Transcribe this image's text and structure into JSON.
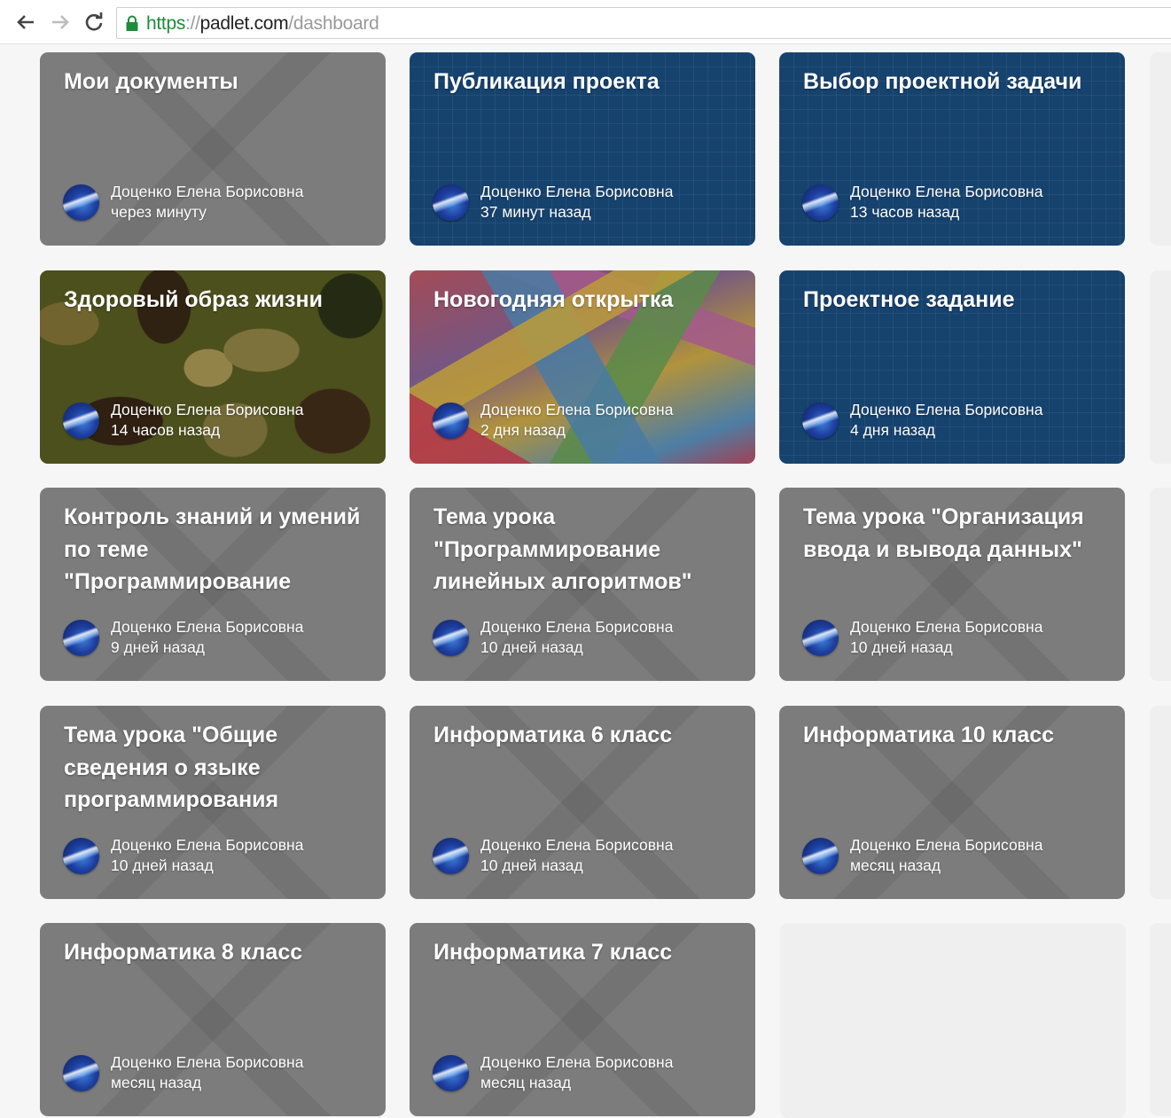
{
  "browser": {
    "url_scheme": "https",
    "url_sep": "://",
    "url_host": "padlet.com",
    "url_path": "/dashboard"
  },
  "padlets": [
    {
      "title": "Мои документы",
      "author": "Доценко Елена Борисовна",
      "time": "через минуту",
      "bg": "gray"
    },
    {
      "title": "Публикация проекта",
      "author": "Доценко Елена Борисовна",
      "time": "37 минут назад",
      "bg": "blue"
    },
    {
      "title": "Выбор проектной задачи",
      "author": "Доценко Елена Борисовна",
      "time": "13 часов назад",
      "bg": "blue"
    },
    {
      "title": "Здоровый образ жизни",
      "author": "Доценко Елена Борисовна",
      "time": "14 часов назад",
      "bg": "camo"
    },
    {
      "title": "Новогодняя открытка",
      "author": "Доценко Елена Борисовна",
      "time": "2 дня назад",
      "bg": "colorful"
    },
    {
      "title": "Проектное задание",
      "author": "Доценко Елена Борисовна",
      "time": "4 дня назад",
      "bg": "blue"
    },
    {
      "title": "Контроль знаний и умений по теме \"Программирование",
      "author": "Доценко Елена Борисовна",
      "time": "9 дней назад",
      "bg": "gray"
    },
    {
      "title": "Тема урока \"Программирование линейных алгоритмов\"",
      "author": "Доценко Елена Борисовна",
      "time": "10 дней назад",
      "bg": "gray"
    },
    {
      "title": "Тема урока \"Организация ввода и вывода данных\"",
      "author": "Доценко Елена Борисовна",
      "time": "10 дней назад",
      "bg": "gray"
    },
    {
      "title": "Тема урока \"Общие сведения о языке программирования",
      "author": "Доценко Елена Борисовна",
      "time": "10 дней назад",
      "bg": "gray"
    },
    {
      "title": "Информатика 6 класс",
      "author": "Доценко Елена Борисовна",
      "time": "10 дней назад",
      "bg": "gray"
    },
    {
      "title": "Информатика 10 класс",
      "author": "Доценко Елена Борисовна",
      "time": "месяц назад",
      "bg": "gray"
    },
    {
      "title": "Информатика 8 класс",
      "author": "Доценко Елена Борисовна",
      "time": "месяц назад",
      "bg": "gray"
    },
    {
      "title": "Информатика 7 класс",
      "author": "Доценко Елена Борисовна",
      "time": "месяц назад",
      "bg": "gray"
    }
  ]
}
